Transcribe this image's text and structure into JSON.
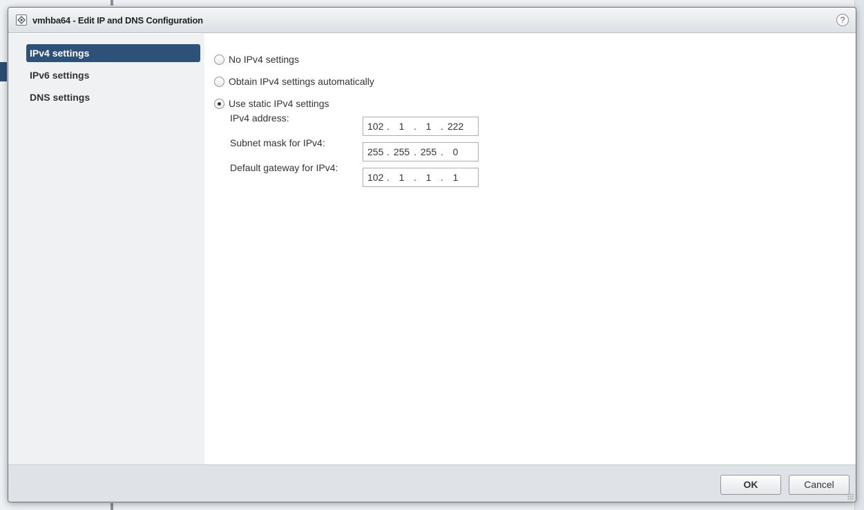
{
  "dialog": {
    "title": "vmhba64 - Edit IP and DNS Configuration",
    "help": "?"
  },
  "sidebar": {
    "items": [
      {
        "label": "IPv4 settings",
        "active": true
      },
      {
        "label": "IPv6 settings",
        "active": false
      },
      {
        "label": "DNS settings",
        "active": false
      }
    ]
  },
  "ipv4": {
    "options": [
      {
        "label": "No IPv4 settings",
        "selected": false
      },
      {
        "label": "Obtain IPv4 settings automatically",
        "selected": false
      },
      {
        "label": "Use static IPv4 settings",
        "selected": true
      }
    ],
    "fields": {
      "address": {
        "label": "IPv4 address:",
        "octets": [
          "102",
          "1",
          "1",
          "222"
        ]
      },
      "subnet": {
        "label": "Subnet mask for IPv4:",
        "octets": [
          "255",
          "255",
          "255",
          "0"
        ]
      },
      "gateway": {
        "label": "Default gateway for IPv4:",
        "octets": [
          "102",
          "1",
          "1",
          "1"
        ]
      }
    }
  },
  "footer": {
    "ok_label": "OK",
    "cancel_label": "Cancel"
  },
  "colors": {
    "accent": "#2d5178",
    "sidebar_bg": "#eff1f3",
    "footer_bg": "#dfe3e8"
  }
}
